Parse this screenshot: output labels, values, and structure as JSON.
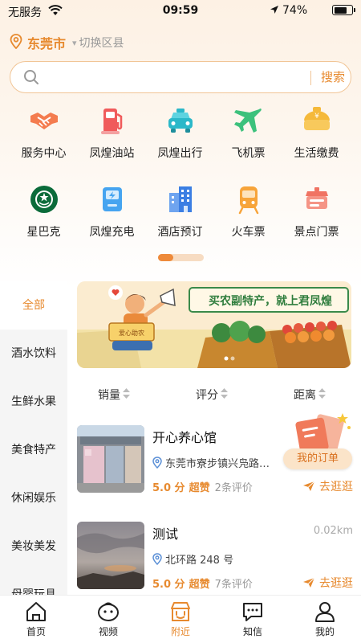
{
  "status_bar": {
    "carrier": "无服务",
    "time": "09:59",
    "battery": "74%",
    "battery_level": 0.74
  },
  "location": {
    "city": "东莞市",
    "switch_label": "切换区县"
  },
  "search": {
    "placeholder": "",
    "button_label": "搜索"
  },
  "services": [
    {
      "label": "服务中心",
      "icon": "handshake-icon"
    },
    {
      "label": "凤煌油站",
      "icon": "fuel-pump-icon"
    },
    {
      "label": "凤煌出行",
      "icon": "taxi-icon"
    },
    {
      "label": "飞机票",
      "icon": "airplane-icon"
    },
    {
      "label": "生活缴费",
      "icon": "bill-payment-icon"
    },
    {
      "label": "星巴克",
      "icon": "starbucks-logo-icon"
    },
    {
      "label": "凤煌充电",
      "icon": "charging-icon"
    },
    {
      "label": "酒店预订",
      "icon": "hotel-icon"
    },
    {
      "label": "火车票",
      "icon": "train-icon"
    },
    {
      "label": "景点门票",
      "icon": "ticket-icon"
    }
  ],
  "pager": {
    "pages": 3,
    "current": 1
  },
  "categories": [
    {
      "label": "全部",
      "active": true
    },
    {
      "label": "酒水饮料",
      "active": false
    },
    {
      "label": "生鲜水果",
      "active": false
    },
    {
      "label": "美食特产",
      "active": false
    },
    {
      "label": "休闲娱乐",
      "active": false
    },
    {
      "label": "美妆美发",
      "active": false
    },
    {
      "label": "母婴玩具",
      "active": false
    }
  ],
  "banner": {
    "slogan": "买农副特产，就上君凤煌",
    "sign_text": "爱心助农"
  },
  "sort": {
    "sales": "销量",
    "rating": "评分",
    "distance": "距离"
  },
  "shops": [
    {
      "name": "开心养心馆",
      "distance": "",
      "address": "东莞市寮步镇兴凫路…",
      "score": "5.0 分",
      "level": "超赞",
      "reviews": "2条评价",
      "go_label": "去逛逛"
    },
    {
      "name": "测试",
      "distance": "0.02km",
      "address": "北环路 248 号",
      "score": "5.0 分",
      "level": "超赞",
      "reviews": "7条评价",
      "go_label": "去逛逛"
    }
  ],
  "order_button": {
    "label": "我的订单"
  },
  "tabs": [
    {
      "label": "首页",
      "icon": "home-icon",
      "active": false
    },
    {
      "label": "视频",
      "icon": "video-icon",
      "active": false
    },
    {
      "label": "附近",
      "icon": "nearby-shop-icon",
      "active": true
    },
    {
      "label": "知信",
      "icon": "message-icon",
      "active": false
    },
    {
      "label": "我的",
      "icon": "profile-icon",
      "active": false
    }
  ],
  "colors": {
    "accent": "#e78a2f",
    "accent_light": "#fbe4c9",
    "panel": "#f5f5f5"
  }
}
